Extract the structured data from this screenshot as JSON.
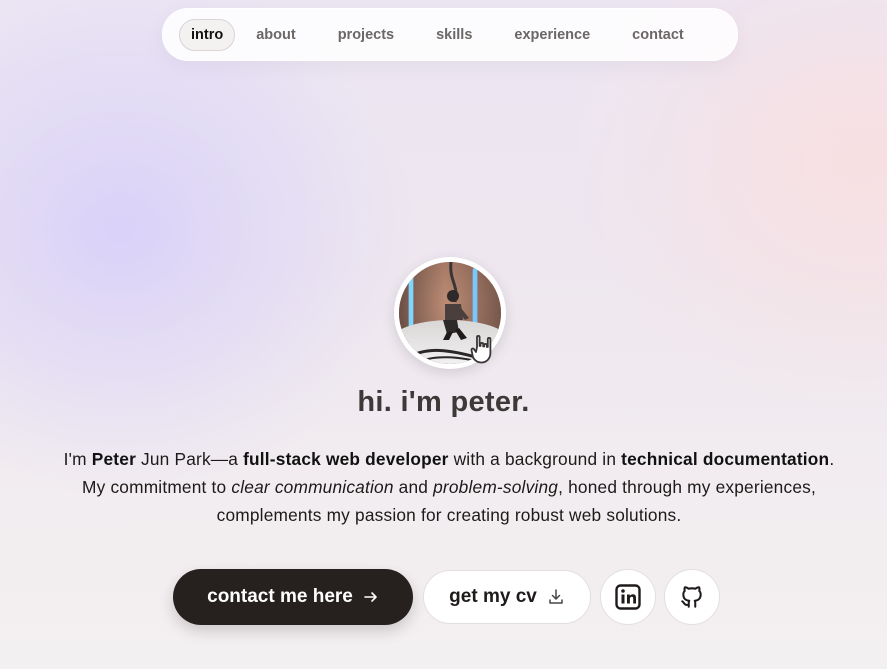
{
  "nav": {
    "items": [
      {
        "label": "intro",
        "active": true
      },
      {
        "label": "about",
        "active": false
      },
      {
        "label": "projects",
        "active": false
      },
      {
        "label": "skills",
        "active": false
      },
      {
        "label": "experience",
        "active": false
      },
      {
        "label": "contact",
        "active": false
      }
    ]
  },
  "hero": {
    "headline": "hi. i'm peter.",
    "bio": {
      "t1": "I'm ",
      "name_first": "Peter",
      "t2": " Jun Park—a ",
      "role": "full-stack web developer",
      "t3": " with a background in ",
      "background": "technical documentation",
      "t4": ". My commitment to ",
      "value1": "clear communication",
      "t5": " and ",
      "value2": "problem-solving",
      "t6": ", honed through my experiences, complements my passion for creating robust web solutions."
    }
  },
  "actions": {
    "contact_label": "contact me here",
    "contact_icon": "arrow-right-icon",
    "cv_label": "get my cv",
    "cv_icon": "download-icon",
    "linkedin_icon": "linkedin-icon",
    "github_icon": "github-icon"
  },
  "colors": {
    "primary_button": "#26201f",
    "text": "#1f1b1a",
    "headline": "#3d3938"
  }
}
